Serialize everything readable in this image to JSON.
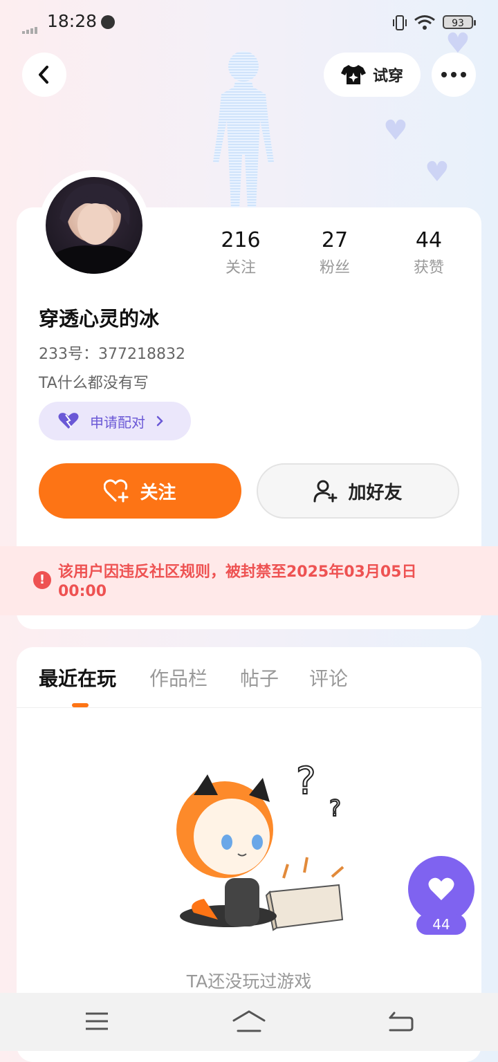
{
  "status_bar": {
    "time": "18:28",
    "battery": "93"
  },
  "header": {
    "tryon_label": "试穿"
  },
  "profile": {
    "name": "穿透心灵的冰",
    "uid": "233号：377218832",
    "bio": "TA什么都没有写",
    "stats": [
      {
        "value": "216",
        "label": "关注"
      },
      {
        "value": "27",
        "label": "粉丝"
      },
      {
        "value": "44",
        "label": "获赞"
      }
    ],
    "pair_label": "申请配对",
    "follow_label": "关注",
    "add_friend_label": "加好友",
    "ban_notice": "该用户因违反社区规则，被封禁至2025年03月05日 00:00"
  },
  "tabs": [
    {
      "label": "最近在玩",
      "active": true
    },
    {
      "label": "作品栏",
      "active": false
    },
    {
      "label": "帖子",
      "active": false
    },
    {
      "label": "评论",
      "active": false
    }
  ],
  "empty_state": {
    "text": "TA还没玩过游戏"
  },
  "like_fab": {
    "count": "44"
  },
  "colors": {
    "accent_orange": "#fd7415",
    "purple": "#7f63f0",
    "ban_red": "#ee5252"
  },
  "icons": [
    "back-icon",
    "tshirt-icon",
    "more-icon",
    "heart-icon",
    "heart-plus-icon",
    "user-plus-icon",
    "alert-icon",
    "menu-icon",
    "home-icon",
    "return-icon"
  ]
}
